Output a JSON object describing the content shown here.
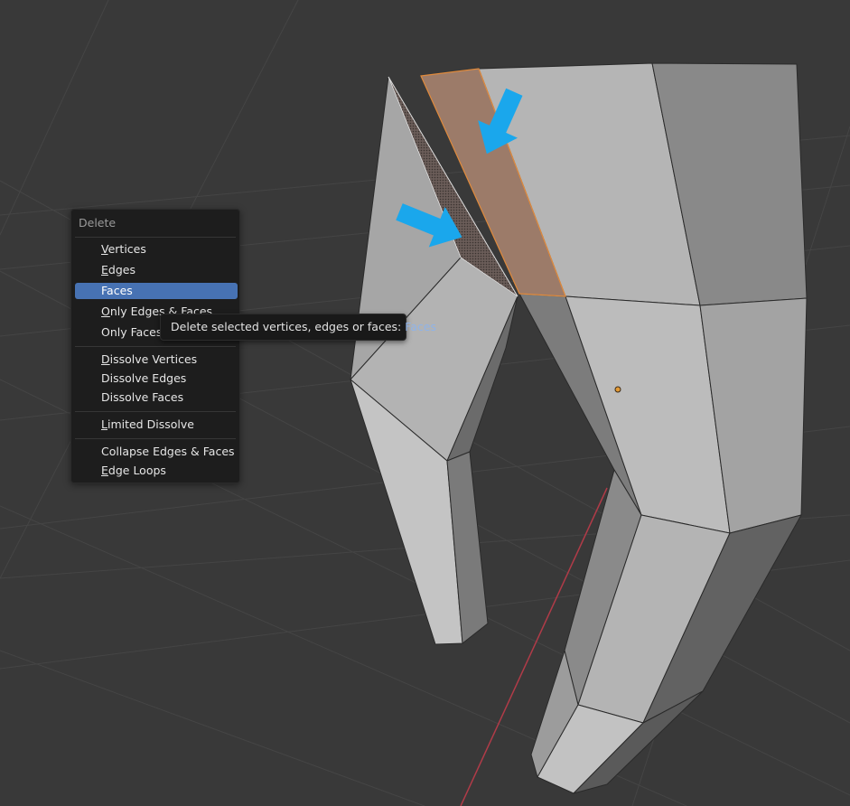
{
  "menu": {
    "title": "Delete",
    "items": [
      {
        "label": "Vertices"
      },
      {
        "label": "Edges"
      },
      {
        "label": "Faces"
      },
      {
        "label": "Only Edges & Faces"
      },
      {
        "label": "Only Faces"
      },
      {
        "label": "Dissolve Vertices"
      },
      {
        "label": "Dissolve Edges"
      },
      {
        "label": "Dissolve Faces"
      },
      {
        "label": "Limited Dissolve"
      },
      {
        "label": "Collapse Edges & Faces"
      },
      {
        "label": "Edge Loops"
      }
    ],
    "active_item": "Faces"
  },
  "tooltip": {
    "text": "Delete selected vertices, edges or faces:",
    "value": "Faces"
  },
  "colors": {
    "background": "#393939",
    "menu_highlight": "#4772b3",
    "selection_orange": "#d68a4c",
    "annotation_arrow": "#1aa7ec",
    "x_axis": "#b03b48"
  }
}
